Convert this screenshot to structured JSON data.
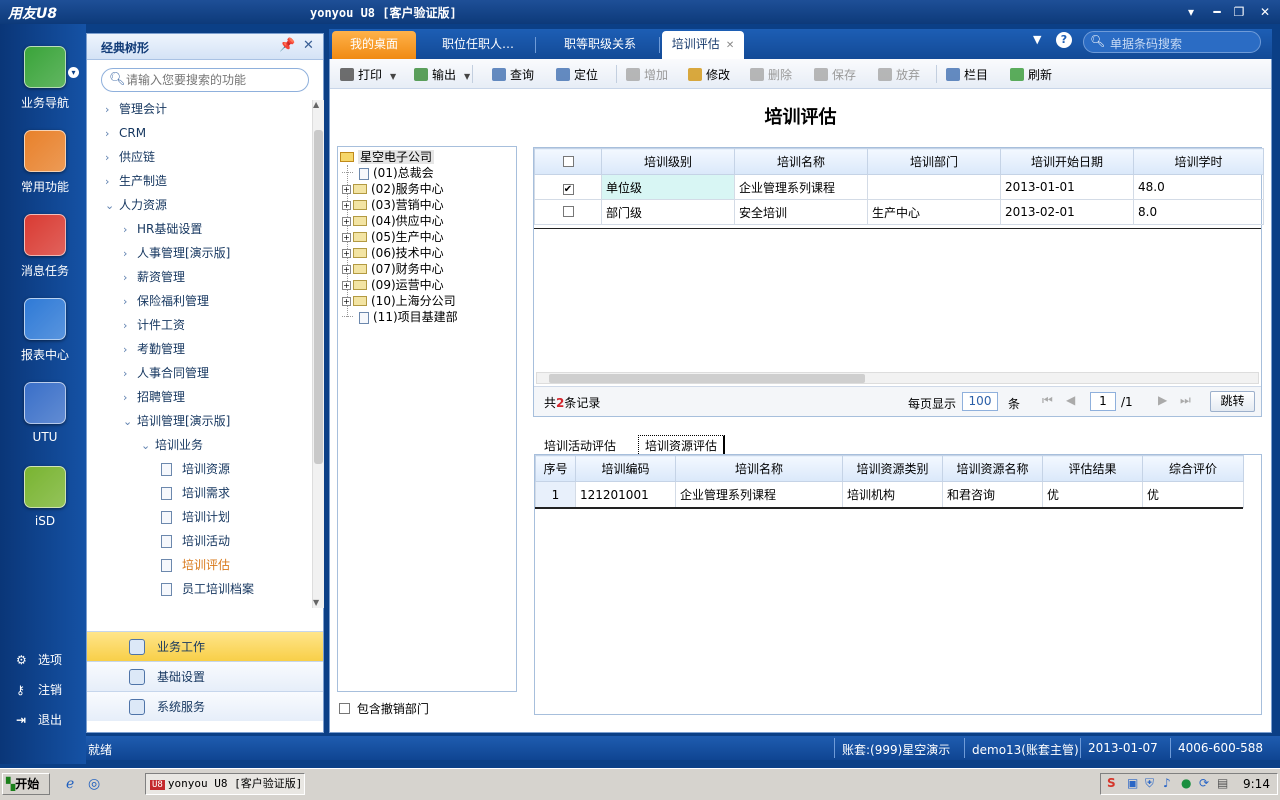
{
  "window": {
    "logo": "用友U8",
    "title": "yonyou U8 [客户验证版]",
    "buttons": [
      "▾",
      "━",
      "❐",
      "✕"
    ]
  },
  "leftnav": {
    "items": [
      {
        "label": "业务导航",
        "icon": "business-nav-icon",
        "color": "#3aa43a"
      },
      {
        "label": "常用功能",
        "icon": "star-icon",
        "color": "#e8812b"
      },
      {
        "label": "消息任务",
        "icon": "envelope-icon",
        "color": "#d93b33"
      },
      {
        "label": "报表中心",
        "icon": "report-icon",
        "color": "#2f7ad6"
      },
      {
        "label": "UTU",
        "icon": "utu-icon",
        "color": "#3a6fc8"
      },
      {
        "label": "iSD",
        "icon": "isd-icon",
        "color": "#79b431"
      }
    ],
    "bottom": [
      {
        "label": "选项",
        "icon": "gear-icon"
      },
      {
        "label": "注销",
        "icon": "key-icon"
      },
      {
        "label": "退出",
        "icon": "exit-icon"
      }
    ]
  },
  "treepanel": {
    "title": "经典树形",
    "search_placeholder": "请输入您要搜索的功能",
    "items": [
      {
        "label": "管理会计",
        "level": 0,
        "chev": "›"
      },
      {
        "label": "CRM",
        "level": 0,
        "chev": "›"
      },
      {
        "label": "供应链",
        "level": 0,
        "chev": "›"
      },
      {
        "label": "生产制造",
        "level": 0,
        "chev": "›"
      },
      {
        "label": "人力资源",
        "level": 0,
        "chev": "⌄"
      },
      {
        "label": "HR基础设置",
        "level": 1,
        "chev": "›"
      },
      {
        "label": "人事管理[演示版]",
        "level": 1,
        "chev": "›"
      },
      {
        "label": "薪资管理",
        "level": 1,
        "chev": "›"
      },
      {
        "label": "保险福利管理",
        "level": 1,
        "chev": "›"
      },
      {
        "label": "计件工资",
        "level": 1,
        "chev": "›"
      },
      {
        "label": "考勤管理",
        "level": 1,
        "chev": "›"
      },
      {
        "label": "人事合同管理",
        "level": 1,
        "chev": "›"
      },
      {
        "label": "招聘管理",
        "level": 1,
        "chev": "›"
      },
      {
        "label": "培训管理[演示版]",
        "level": 1,
        "chev": "⌄"
      },
      {
        "label": "培训业务",
        "level": 2,
        "chev": "⌄"
      },
      {
        "label": "培训资源",
        "level": 3,
        "chev": ""
      },
      {
        "label": "培训需求",
        "level": 3,
        "chev": ""
      },
      {
        "label": "培训计划",
        "level": 3,
        "chev": ""
      },
      {
        "label": "培训活动",
        "level": 3,
        "chev": ""
      },
      {
        "label": "培训评估",
        "level": 3,
        "chev": "",
        "active": true
      },
      {
        "label": "员工培训档案",
        "level": 3,
        "chev": ""
      }
    ],
    "accordion": [
      "业务工作",
      "基础设置",
      "系统服务"
    ]
  },
  "tabs": [
    {
      "label": "我的桌面"
    },
    {
      "label": "职位任职人…"
    },
    {
      "label": "职等职级关系"
    },
    {
      "label": "培训评估",
      "close": "✕"
    }
  ],
  "tabsearch_placeholder": "单据条码搜索",
  "toolbar": [
    {
      "label": "打印",
      "dd": true,
      "enabled": true,
      "color": "#555"
    },
    {
      "label": "输出",
      "dd": true,
      "enabled": true,
      "color": "#3f8f3f"
    },
    {
      "label": "查询",
      "enabled": true,
      "color": "#4a77b5"
    },
    {
      "label": "定位",
      "enabled": true,
      "color": "#4a77b5"
    },
    {
      "label": "增加",
      "enabled": false,
      "color": "#aaa"
    },
    {
      "label": "修改",
      "enabled": true,
      "color": "#d49a1c"
    },
    {
      "label": "删除",
      "enabled": false,
      "color": "#aaa"
    },
    {
      "label": "保存",
      "enabled": false,
      "color": "#aaa"
    },
    {
      "label": "放弃",
      "enabled": false,
      "color": "#aaa"
    },
    {
      "label": "栏目",
      "enabled": true,
      "color": "#4a77b5"
    },
    {
      "label": "刷新",
      "enabled": true,
      "color": "#3f9f3f"
    }
  ],
  "page_title": "培训评估",
  "orgtree": {
    "root": "星空电子公司",
    "nodes": [
      {
        "label": "(01)总裁会",
        "leaf": true
      },
      {
        "label": "(02)服务中心"
      },
      {
        "label": "(03)营销中心"
      },
      {
        "label": "(04)供应中心"
      },
      {
        "label": "(05)生产中心"
      },
      {
        "label": "(06)技术中心"
      },
      {
        "label": "(07)财务中心"
      },
      {
        "label": "(09)运营中心"
      },
      {
        "label": "(10)上海分公司"
      },
      {
        "label": "(11)项目基建部",
        "leaf": true
      }
    ],
    "include_cancelled": "包含撤销部门"
  },
  "grid1": {
    "columns": [
      "培训级别",
      "培训名称",
      "培训部门",
      "培训开始日期",
      "培训学时"
    ],
    "rows": [
      {
        "checked": true,
        "cells": [
          "单位级",
          "企业管理系列课程",
          "",
          "2013-01-01",
          "48.0"
        ]
      },
      {
        "checked": false,
        "cells": [
          "部门级",
          "安全培训",
          "生产中心",
          "2013-02-01",
          "8.0"
        ]
      }
    ]
  },
  "pager": {
    "prefix": "共",
    "count": "2",
    "suffix": "条记录",
    "per_page_label": "每页显示",
    "per_page": "100",
    "unit": "条",
    "page": "1",
    "total": "/1",
    "jump": "跳转"
  },
  "subtabs": [
    "培训活动评估",
    "培训资源评估"
  ],
  "grid2": {
    "columns": [
      "序号",
      "培训编码",
      "培训名称",
      "培训资源类别",
      "培训资源名称",
      "评估结果",
      "综合评价"
    ],
    "rows": [
      [
        "1",
        "121201001",
        "企业管理系列课程",
        "培训机构",
        "和君咨询",
        "优",
        "优"
      ]
    ]
  },
  "statusbar": {
    "status": "就绪",
    "account": "账套:(999)星空演示",
    "user": "demo13(账套主管)",
    "date": "2013-01-07",
    "phone": "4006-600-588"
  },
  "taskbar": {
    "start": "开始",
    "task": "yonyou U8 [客户验证版]",
    "time": "9:14"
  }
}
